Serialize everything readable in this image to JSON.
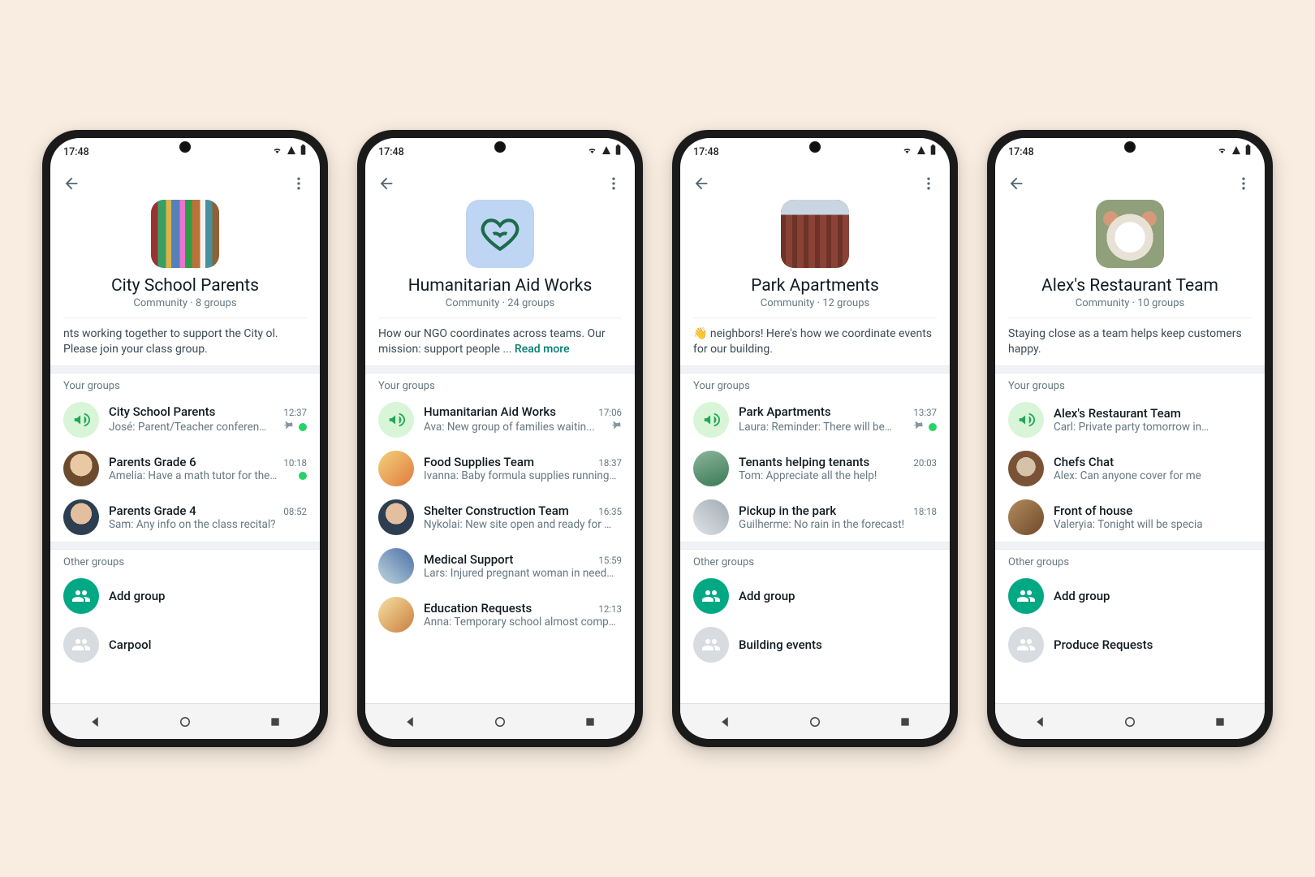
{
  "status_time": "17:48",
  "section_your": "Your groups",
  "section_other": "Other groups",
  "add_group_label": "Add group",
  "phones": [
    {
      "title": "City School Parents",
      "subtitle": "Community · 8 groups",
      "desc_prefix": "nts working together to support the City ol. Please join your class group.",
      "readmore": "",
      "img": "books",
      "your": [
        {
          "name": "City School Parents",
          "msg": "José: Parent/Teacher conferen…",
          "time": "12:37",
          "pin": true,
          "dot": true,
          "avatar": "announce"
        },
        {
          "name": "Parents Grade 6",
          "msg": "Amelia: Have a math tutor for the…",
          "time": "10:18",
          "pin": false,
          "dot": true,
          "avatar": "p1"
        },
        {
          "name": "Parents Grade 4",
          "msg": "Sam: Any info on the class recital?",
          "time": "08:52",
          "pin": false,
          "dot": false,
          "avatar": "p3"
        }
      ],
      "other": [
        {
          "name": "Carpool",
          "avatar": "muted"
        }
      ],
      "show_add": true,
      "cutoff": "left"
    },
    {
      "title": "Humanitarian Aid Works",
      "subtitle": "Community · 24 groups",
      "desc_prefix": "How our NGO coordinates across teams. Our mission: support people ... ",
      "readmore": "Read more",
      "img": "heart",
      "your": [
        {
          "name": "Humanitarian Aid Works",
          "msg": "Ava: New group of families waitin...",
          "time": "17:06",
          "pin": true,
          "dot": false,
          "avatar": "announce"
        },
        {
          "name": "Food Supplies Team",
          "msg": "Ivanna: Baby formula supplies running …",
          "time": "18:37",
          "pin": false,
          "dot": false,
          "avatar": "p2"
        },
        {
          "name": "Shelter Construction Team",
          "msg": "Nykolai: New site open and ready for …",
          "time": "16:35",
          "pin": false,
          "dot": false,
          "avatar": "p3"
        },
        {
          "name": "Medical Support",
          "msg": "Lars: Injured pregnant woman in need…",
          "time": "15:59",
          "pin": false,
          "dot": false,
          "avatar": "p4"
        },
        {
          "name": "Education Requests",
          "msg": "Anna: Temporary school almost comp…",
          "time": "12:13",
          "pin": false,
          "dot": false,
          "avatar": "p5"
        }
      ],
      "other": [],
      "show_add": false,
      "cutoff": ""
    },
    {
      "title": "Park Apartments",
      "subtitle": "Community · 12 groups",
      "desc_prefix": "👋 neighbors! Here's how we coordinate events for our building.",
      "readmore": "",
      "img": "building",
      "your": [
        {
          "name": "Park Apartments",
          "msg": "Laura: Reminder: There will be…",
          "time": "13:37",
          "pin": true,
          "dot": true,
          "avatar": "announce"
        },
        {
          "name": "Tenants helping tenants",
          "msg": "Tom: Appreciate all the help!",
          "time": "20:03",
          "pin": false,
          "dot": false,
          "avatar": "p6"
        },
        {
          "name": "Pickup in the park",
          "msg": "Guilherme: No rain in the forecast!",
          "time": "18:18",
          "pin": false,
          "dot": false,
          "avatar": "p7"
        }
      ],
      "other": [
        {
          "name": "Building events",
          "avatar": "muted"
        }
      ],
      "show_add": true,
      "cutoff": ""
    },
    {
      "title": "Alex's Restaurant Team",
      "subtitle": "Community · 10 groups",
      "desc_prefix": "Staying close as a team helps keep customers happy.",
      "readmore": "",
      "img": "food",
      "your": [
        {
          "name": "Alex's Restaurant Team",
          "msg": "Carl: Private party tomorrow in…",
          "time": "",
          "pin": false,
          "dot": false,
          "avatar": "announce"
        },
        {
          "name": "Chefs Chat",
          "msg": "Alex: Can anyone cover for me",
          "time": "",
          "pin": false,
          "dot": false,
          "avatar": "p8"
        },
        {
          "name": "Front of house",
          "msg": "Valeryia: Tonight will be specia",
          "time": "",
          "pin": false,
          "dot": false,
          "avatar": "p9"
        }
      ],
      "other": [
        {
          "name": "Produce Requests",
          "avatar": "muted"
        }
      ],
      "show_add": true,
      "cutoff": "right"
    }
  ]
}
